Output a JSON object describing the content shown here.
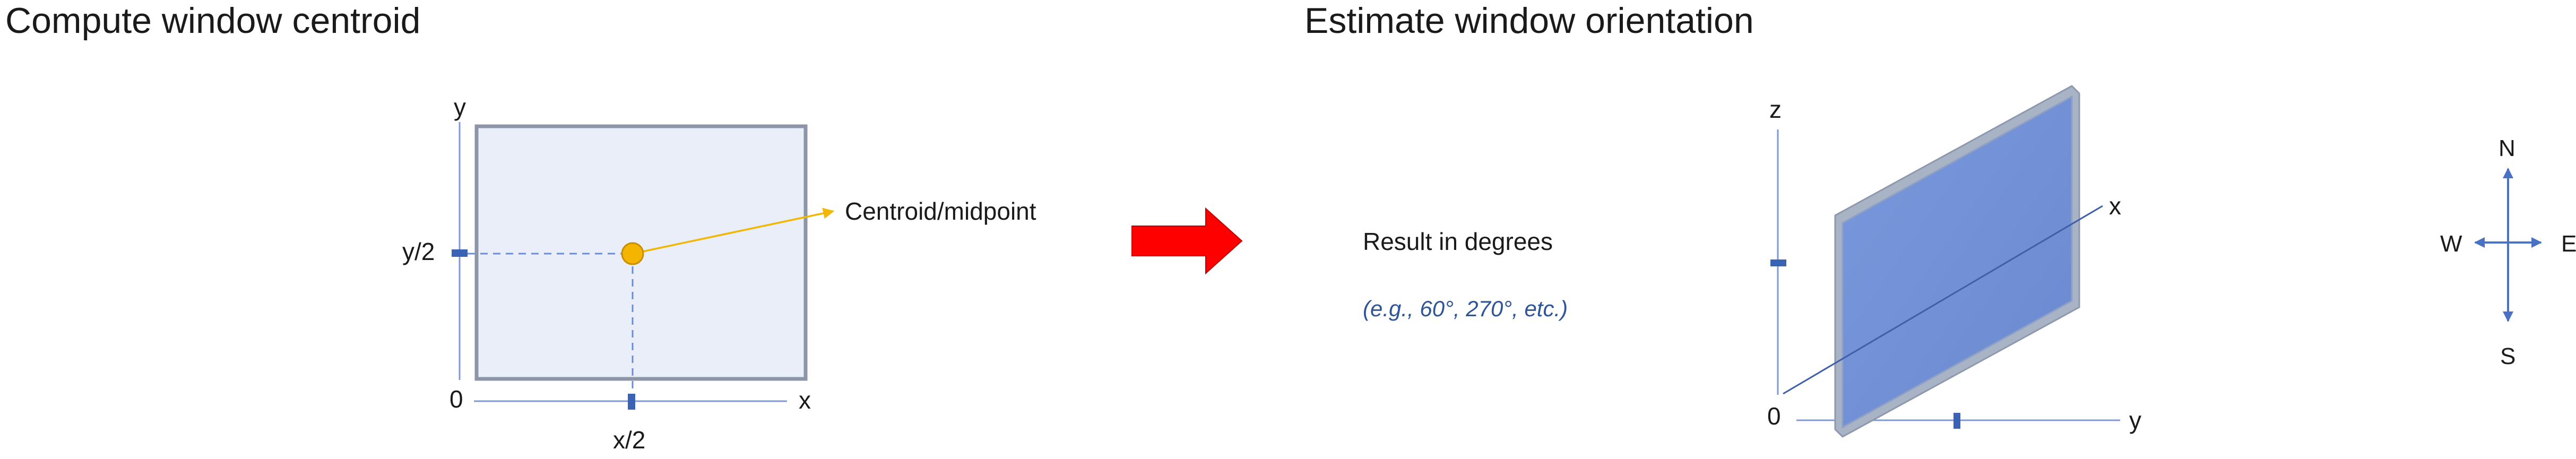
{
  "titles": {
    "left": "Compute window centroid",
    "right": "Estimate window orientation"
  },
  "centroid_diagram": {
    "axis_y": "y",
    "axis_x": "x",
    "origin": "0",
    "half_y": "y/2",
    "half_x": "x/2",
    "callout": "Centroid/midpoint"
  },
  "result": {
    "heading": "Result in degrees",
    "example": "(e.g., 60°, 270°, etc.)"
  },
  "orientation_diagram": {
    "axis_z": "z",
    "axis_x": "x",
    "axis_y": "y",
    "origin": "0"
  },
  "compass": {
    "north": "N",
    "south": "S",
    "east": "E",
    "west": "W"
  },
  "colors": {
    "window_fill": "#e9eef8",
    "window_border": "#8c96a8",
    "axis": "#4a72c4",
    "marker": "#3a63b5",
    "centroid_dot": "#f2b705",
    "callout_line": "#f2b705",
    "arrow": "#ff0000",
    "glass": "#6f8fd6",
    "note_text": "#2e5597"
  }
}
